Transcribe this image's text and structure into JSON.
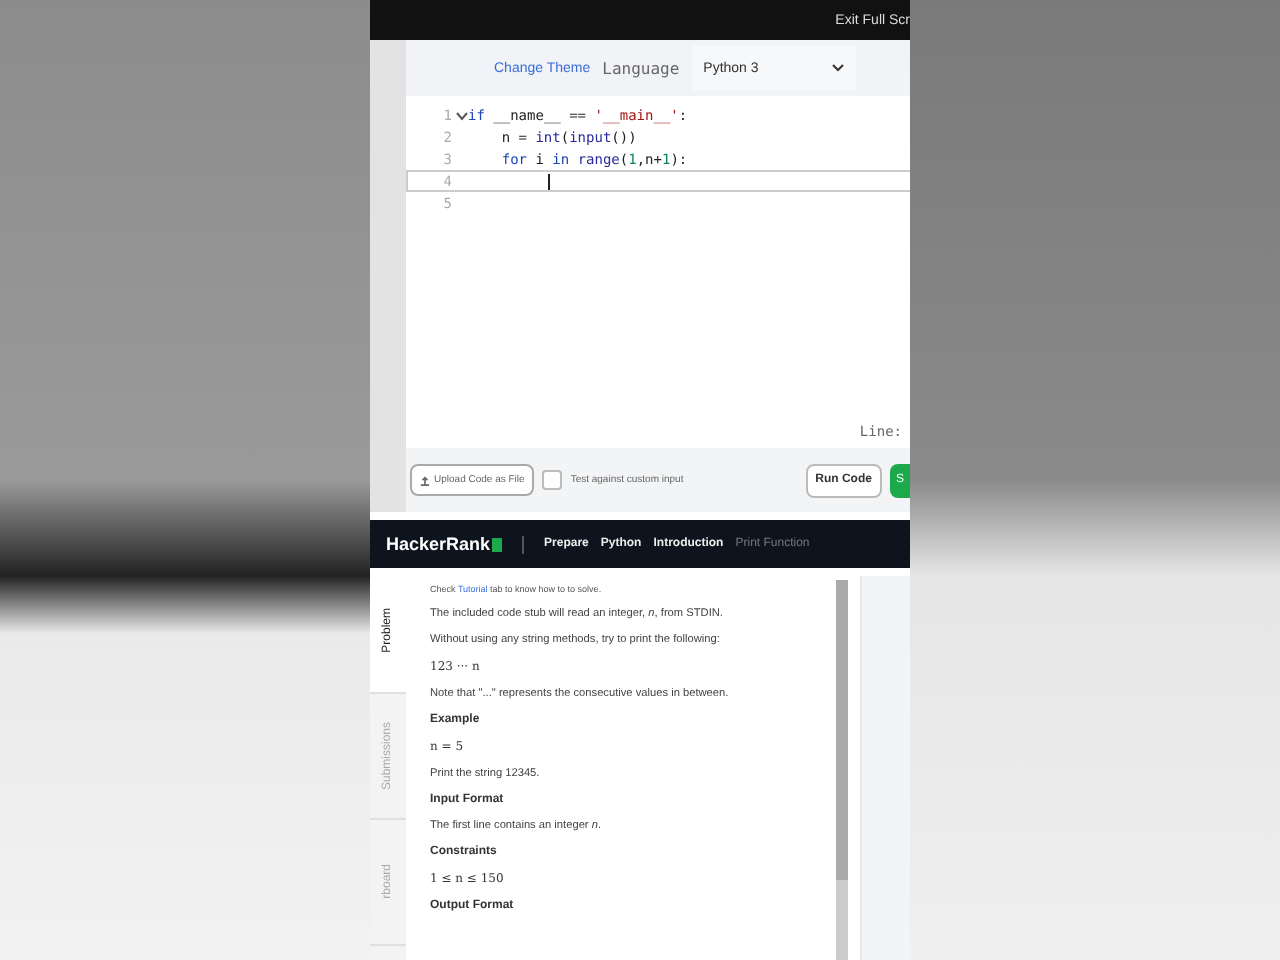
{
  "top_bar": {
    "exit_label": "Exit Full Scr"
  },
  "editor_header": {
    "theme_link": "Change Theme",
    "language_label": "Language",
    "language_value": "Python 3"
  },
  "code_lines": [
    {
      "number": "1",
      "foldable": true,
      "current": false,
      "tokens": [
        {
          "text": "if ",
          "kind": "keyword"
        },
        {
          "text": "__name__",
          "kind": "plain"
        },
        {
          "text": " == ",
          "kind": "plain"
        },
        {
          "text": "'__main__'",
          "kind": "string"
        },
        {
          "text": ":",
          "kind": "plain"
        }
      ]
    },
    {
      "number": "2",
      "foldable": false,
      "current": false,
      "tokens": [
        {
          "text": "    n = ",
          "kind": "plain"
        },
        {
          "text": "int",
          "kind": "builtin"
        },
        {
          "text": "(",
          "kind": "plain"
        },
        {
          "text": "input",
          "kind": "builtin"
        },
        {
          "text": "())",
          "kind": "plain"
        }
      ]
    },
    {
      "number": "3",
      "foldable": false,
      "current": false,
      "tokens": [
        {
          "text": "    for ",
          "kind": "keyword"
        },
        {
          "text": "i ",
          "kind": "plain"
        },
        {
          "text": "in ",
          "kind": "keyword"
        },
        {
          "text": "range",
          "kind": "builtin"
        },
        {
          "text": "(",
          "kind": "plain"
        },
        {
          "text": "1",
          "kind": "number"
        },
        {
          "text": ",n+",
          "kind": "plain"
        },
        {
          "text": "1",
          "kind": "number"
        },
        {
          "text": "):",
          "kind": "plain"
        }
      ]
    },
    {
      "number": "4",
      "foldable": false,
      "current": true
    },
    {
      "number": "5",
      "foldable": false,
      "current": false
    }
  ],
  "status": {
    "line_label": "Line:"
  },
  "actions": {
    "upload_label": "Upload Code as File",
    "custom_input": {
      "label": "Test against custom input",
      "checked": false
    },
    "run_label": "Run Code",
    "submit_label": "S"
  },
  "nav": {
    "logo": "HackerRank",
    "breadcrumbs": [
      {
        "label": "Prepare",
        "current": false
      },
      {
        "label": "Python",
        "current": false
      },
      {
        "label": "Introduction",
        "current": false
      },
      {
        "label": "Print Function",
        "current": true
      }
    ]
  },
  "side_tabs": [
    {
      "label": "Problem",
      "selected": true
    },
    {
      "label": "Submissions",
      "selected": false
    },
    {
      "label": "rboard",
      "selected": false
    }
  ],
  "problem": [
    {
      "kind": "small",
      "link": "Tutorial",
      "before": "Check ",
      "after": " tab to know how to to solve."
    },
    {
      "kind": "para",
      "text": "The included code stub will read an integer, *n*, from STDIN."
    },
    {
      "kind": "para",
      "text": "Without using any string methods, try to print the following:"
    },
    {
      "kind": "math",
      "text": "123 ··· n"
    },
    {
      "kind": "para",
      "text": "Note that \"...\" represents the consecutive values in between."
    },
    {
      "kind": "heading",
      "text": "Example"
    },
    {
      "kind": "math",
      "text": "n = 5"
    },
    {
      "kind": "para",
      "text": "Print the string 12345."
    },
    {
      "kind": "heading",
      "text": "Input Format"
    },
    {
      "kind": "para",
      "text": "The first line contains an integer *n*."
    },
    {
      "kind": "heading",
      "text": "Constraints"
    },
    {
      "kind": "math",
      "text": "1 ≤ n ≤ 150"
    },
    {
      "kind": "heading",
      "text": "Output Format"
    }
  ]
}
